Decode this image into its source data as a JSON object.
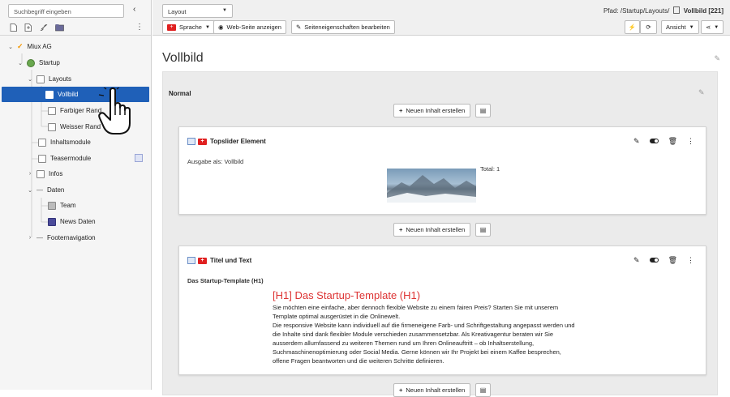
{
  "sidebar": {
    "search_placeholder": "Suchbegriff eingeben",
    "collapse_icon": "‹",
    "toolbar_icons": [
      "new-page-icon",
      "new-page-inside-icon",
      "link-icon",
      "folder-icon"
    ],
    "tree": [
      {
        "label": "Miux AG",
        "icon": "typo3-logo-icon"
      },
      {
        "label": "Startup",
        "icon": "globe-icon"
      },
      {
        "label": "Layouts",
        "icon": "folder-page-icon"
      },
      {
        "label": "Vollbild",
        "icon": "page-icon",
        "selected": true
      },
      {
        "label": "Farbiger Rand",
        "icon": "page-icon"
      },
      {
        "label": "Weisser Rand",
        "icon": "page-icon"
      },
      {
        "label": "Inhaltsmodule",
        "icon": "page-icon"
      },
      {
        "label": "Teasermodule",
        "icon": "page-icon"
      },
      {
        "label": "Infos",
        "icon": "folder-page-icon"
      },
      {
        "label": "Daten",
        "icon": "spacer-icon"
      },
      {
        "label": "Team",
        "icon": "sysfolder-icon"
      },
      {
        "label": "News Daten",
        "icon": "news-folder-icon"
      },
      {
        "label": "Footernavigation",
        "icon": "spacer-icon"
      }
    ]
  },
  "topbar": {
    "layout_select": "Layout",
    "sprache": "Sprache",
    "webseite": "Web-Seite anzeigen",
    "seiteneigenschaften": "Seiteneigenschaften bearbeiten",
    "path_prefix": "Pfad: /Startup/Layouts/",
    "path_page": "Vollbild [221]",
    "ansicht": "Ansicht"
  },
  "main": {
    "page_title": "Vollbild",
    "column_title": "Normal",
    "new_content": "Neuen Inhalt erstellen",
    "cards": [
      {
        "title": "Topslider Element",
        "ausgabe": "Ausgabe als: Vollbild",
        "total": "Total: 1"
      },
      {
        "title": "Titel und Text",
        "subtitle": "Das Startup-Template (H1)",
        "h1": "[H1] Das Startup-Template (H1)",
        "body": [
          "Sie möchten eine einfache, aber dennoch flexible Website zu einem fairen Preis? Starten Sie mit unserem",
          "Template optimal ausgerüstet in die Onlinewelt.",
          "Die responsive Website kann individuell auf die firmeneigene Farb- und Schriftgestaltung angepasst werden und",
          "die Inhalte sind dank flexibler Module verschieden zusammensetzbar. Als Kreativagentur beraten wir Sie",
          "ausserdem allumfassend zu weiteren Themen rund um Ihren Onlineauftritt – ob Inhaltserstellung,",
          "Suchmaschinenoptimierung oder Social Media. Gerne können wir Ihr Projekt bei einem Kaffee besprechen,",
          "offene Fragen beantworten und die weiteren Schritte definieren."
        ]
      }
    ]
  },
  "colors": {
    "selected_bg": "#1f60b8",
    "flag_red": "#e02020",
    "heading_red": "#dd3333"
  }
}
